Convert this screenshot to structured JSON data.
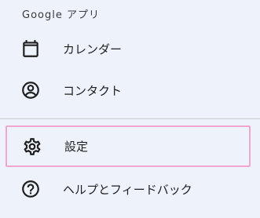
{
  "menu": {
    "section_header": "Google アプリ",
    "items": [
      {
        "label": "カレンダー",
        "icon": "calendar-icon"
      },
      {
        "label": "コンタクト",
        "icon": "contacts-icon"
      },
      {
        "label": "設定",
        "icon": "gear-icon",
        "highlighted": true
      },
      {
        "label": "ヘルプとフィードバック",
        "icon": "help-icon"
      }
    ]
  },
  "colors": {
    "background": "#eef2fb",
    "highlight_border": "#f1a6cf",
    "divider": "#c9cbd1",
    "text": "#1f1f1f"
  }
}
